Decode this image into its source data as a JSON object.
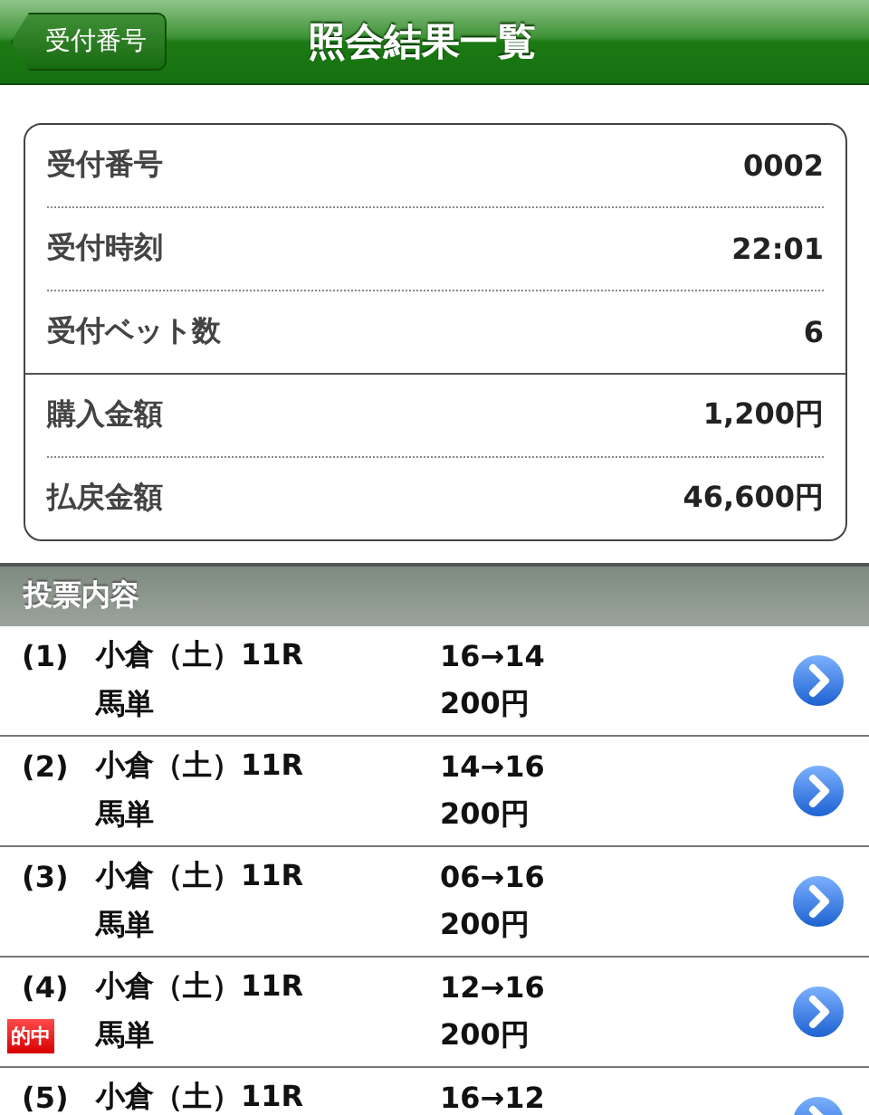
{
  "header": {
    "back_button": "受付番号",
    "title": "照会結果一覧"
  },
  "summary": {
    "groups": [
      [
        {
          "label": "受付番号",
          "value": "0002"
        },
        {
          "label": "受付時刻",
          "value": "22:01"
        },
        {
          "label": "受付ベット数",
          "value": "6"
        }
      ],
      [
        {
          "label": "購入金額",
          "value": "1,200円"
        },
        {
          "label": "払戻金額",
          "value": "46,600円"
        }
      ]
    ]
  },
  "section_title": "投票内容",
  "bets": [
    {
      "number": "(1)",
      "race": "小倉（土）11R",
      "bet_type": "馬単",
      "combination": "16→14",
      "amount": "200円"
    },
    {
      "number": "(2)",
      "race": "小倉（土）11R",
      "bet_type": "馬単",
      "combination": "14→16",
      "amount": "200円"
    },
    {
      "number": "(3)",
      "race": "小倉（土）11R",
      "bet_type": "馬単",
      "combination": "06→16",
      "amount": "200円"
    },
    {
      "number": "(4)",
      "race": "小倉（土）11R",
      "badge": "的中",
      "bet_type": "馬単",
      "combination": "12→16",
      "amount": "200円"
    },
    {
      "number": "(5)",
      "race": "小倉（土）11R",
      "combination": "16→12"
    }
  ]
}
